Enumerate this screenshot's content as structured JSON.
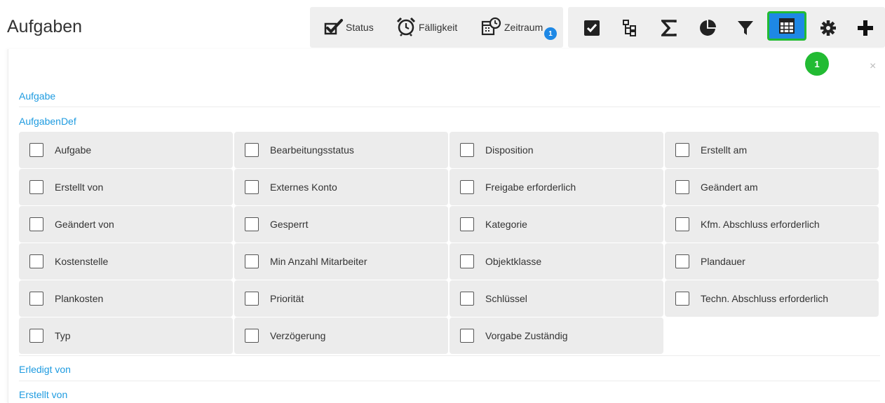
{
  "header": {
    "title": "Aufgaben",
    "filters": {
      "status_label": "Status",
      "faelligkeit_label": "Fälligkeit",
      "zeitraum_label": "Zeitraum",
      "zeitraum_count": "1"
    },
    "toolbar_icons": [
      "check-square-icon",
      "tree-icon",
      "sigma-icon",
      "pie-chart-icon",
      "filter-icon",
      "table-icon",
      "gear-icon",
      "plus-icon"
    ],
    "step_badge": "1"
  },
  "panel": {
    "close_label": "×",
    "sections": {
      "aufgabe": "Aufgabe",
      "aufgabendef": "AufgabenDef",
      "erledigt_von": "Erledigt von",
      "erstellt_von": "Erstellt von"
    },
    "fields": [
      "Aufgabe",
      "Bearbeitungsstatus",
      "Disposition",
      "Erstellt am",
      "Erstellt von",
      "Externes Konto",
      "Freigabe erforderlich",
      "Geändert am",
      "Geändert von",
      "Gesperrt",
      "Kategorie",
      "Kfm. Abschluss erforderlich",
      "Kostenstelle",
      "Min Anzahl Mitarbeiter",
      "Objektklasse",
      "Plandauer",
      "Plankosten",
      "Priorität",
      "Schlüssel",
      "Techn. Abschluss erforderlich",
      "Typ",
      "Verzögerung",
      "Vorgabe Zuständig"
    ]
  },
  "colors": {
    "accent": "#1e88e5",
    "link": "#1e9be0",
    "highlight_border": "#22bb33",
    "cell_bg": "#ececec"
  }
}
